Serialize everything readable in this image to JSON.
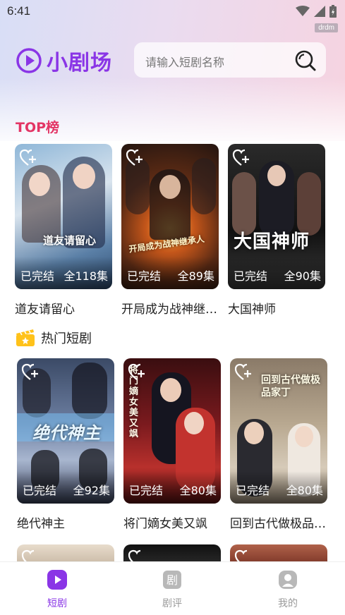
{
  "status_bar": {
    "time": "6:41",
    "badge": "drdm"
  },
  "app": {
    "name": "小剧场",
    "brand_color": "#8a35e6",
    "accent_color": "#e33565"
  },
  "search": {
    "placeholder": "请输入短剧名称"
  },
  "top_section": {
    "title": "TOP榜",
    "items": [
      {
        "title": "道友请留心",
        "status": "已完结",
        "count": "全118集",
        "poster_text": "道友请留心"
      },
      {
        "title": "开局成为战神继承人",
        "status": "已完结",
        "count": "全89集",
        "poster_text": "开局成为战神继承人"
      },
      {
        "title": "大国神师",
        "status": "已完结",
        "count": "全90集",
        "poster_text": "大国神师"
      }
    ]
  },
  "hot_section": {
    "title": "热门短剧",
    "items": [
      {
        "title": "绝代神主",
        "status": "已完结",
        "count": "全92集",
        "poster_text": "绝代神主"
      },
      {
        "title": "将门嫡女美又飒",
        "status": "已完结",
        "count": "全80集",
        "poster_text": "将门嫡女美又飒"
      },
      {
        "title": "回到古代做极品家丁",
        "status": "已完结",
        "count": "全80集",
        "poster_text": "回到古代做极品家丁"
      }
    ]
  },
  "tab_bar": {
    "tabs": [
      {
        "label": "短剧",
        "active": true
      },
      {
        "label": "剧评",
        "active": false
      },
      {
        "label": "我的",
        "active": false
      }
    ],
    "active_color": "#8a35e6",
    "inactive_color": "#9a9a9a"
  }
}
